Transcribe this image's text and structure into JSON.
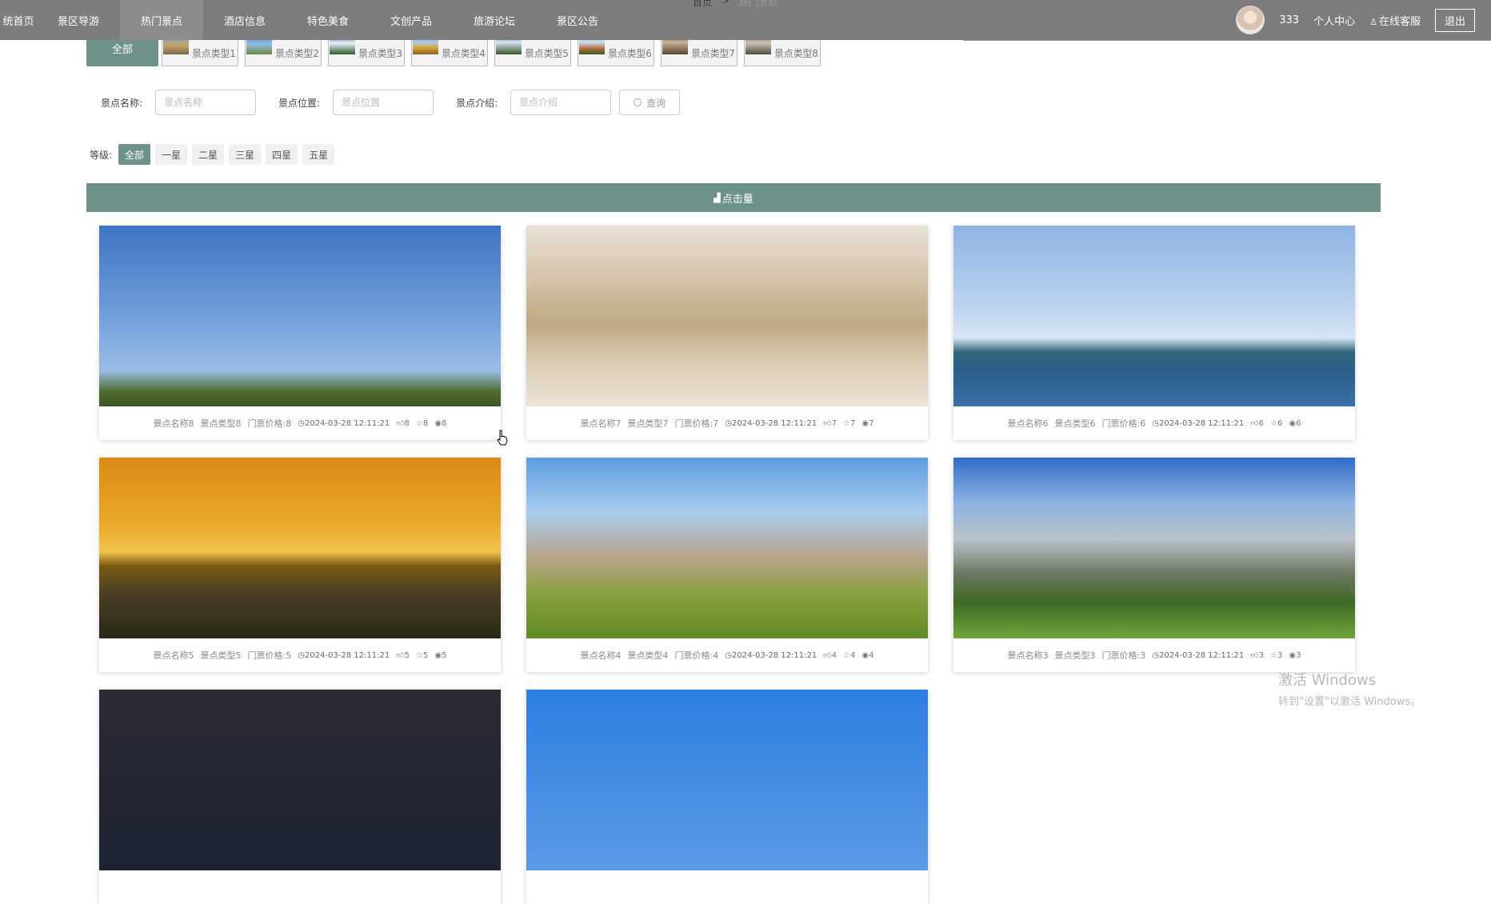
{
  "nav": {
    "items": [
      {
        "label": "统首页",
        "active": false
      },
      {
        "label": "景区导游",
        "active": false
      },
      {
        "label": "热门景点",
        "active": true
      },
      {
        "label": "酒店信息",
        "active": false
      },
      {
        "label": "特色美食",
        "active": false
      },
      {
        "label": "文创产品",
        "active": false
      },
      {
        "label": "旅游论坛",
        "active": false
      },
      {
        "label": "景区公告",
        "active": false
      }
    ],
    "breadcrumb": [
      "首页",
      ">",
      "热门景点"
    ]
  },
  "user": {
    "name": "333",
    "profile_link": "个人中心",
    "service_link": "在线客服",
    "logout_label": "退出"
  },
  "categories": {
    "all_label": "全部",
    "items": [
      "景点类型1",
      "景点类型2",
      "景点类型3",
      "景点类型4",
      "景点类型5",
      "景点类型6",
      "景点类型7",
      "景点类型8"
    ]
  },
  "search": {
    "fields": [
      {
        "label": "景点名称:",
        "placeholder": "景点名称"
      },
      {
        "label": "景点位置:",
        "placeholder": "景点位置"
      },
      {
        "label": "景点介绍:",
        "placeholder": "景点介绍"
      }
    ],
    "button_label": "查询"
  },
  "level": {
    "label": "等级:",
    "options": [
      "全部",
      "一星",
      "二星",
      "三星",
      "四星",
      "五星"
    ],
    "selected": "全部"
  },
  "sort_bar": {
    "label": "点击量"
  },
  "cards": [
    {
      "name": "景点名称8",
      "type": "景点类型8",
      "price": "门票价格:8",
      "time": "2024-03-28 12:11:21",
      "likes": "8",
      "favs": "8",
      "views": "8"
    },
    {
      "name": "景点名称7",
      "type": "景点类型7",
      "price": "门票价格:7",
      "time": "2024-03-28 12:11:21",
      "likes": "7",
      "favs": "7",
      "views": "7"
    },
    {
      "name": "景点名称6",
      "type": "景点类型6",
      "price": "门票价格:6",
      "time": "2024-03-28 12:11:21",
      "likes": "6",
      "favs": "6",
      "views": "6"
    },
    {
      "name": "景点名称5",
      "type": "景点类型5",
      "price": "门票价格:5",
      "time": "2024-03-28 12:11:21",
      "likes": "5",
      "favs": "5",
      "views": "5"
    },
    {
      "name": "景点名称4",
      "type": "景点类型4",
      "price": "门票价格:4",
      "time": "2024-03-28 12:11:21",
      "likes": "4",
      "favs": "4",
      "views": "4"
    },
    {
      "name": "景点名称3",
      "type": "景点类型3",
      "price": "门票价格:3",
      "time": "2024-03-28 12:11:21",
      "likes": "3",
      "favs": "3",
      "views": "3"
    },
    {
      "name": "",
      "type": "",
      "price": "",
      "time": "",
      "likes": "",
      "favs": "",
      "views": ""
    },
    {
      "name": "",
      "type": "",
      "price": "",
      "time": "",
      "likes": "",
      "favs": "",
      "views": ""
    }
  ],
  "watermark": {
    "line1": "激活 Windows",
    "line2": "转到\"设置\"以激活 Windows。"
  },
  "colors": {
    "accent": "#6e9289",
    "topbar": "#7d7d7d"
  }
}
